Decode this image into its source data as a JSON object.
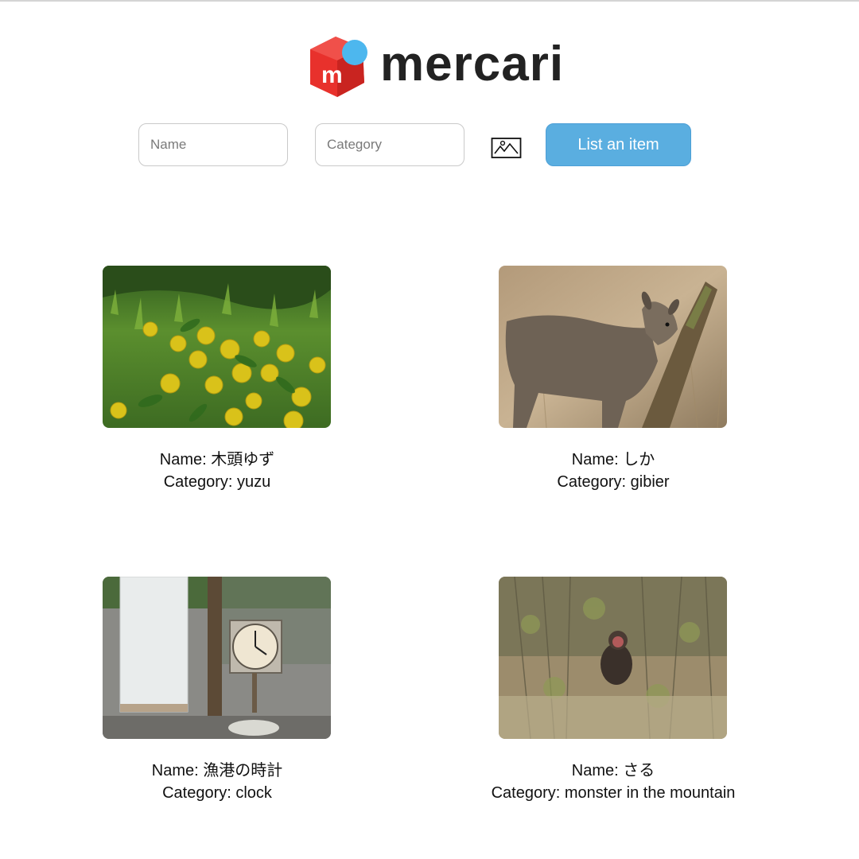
{
  "header": {
    "brand": "mercari",
    "cube_letter": "m",
    "brand_red": "#e8312c",
    "brand_blue": "#4db7ee"
  },
  "form": {
    "name_placeholder": "Name",
    "category_placeholder": "Category",
    "image_icon": "image-upload-icon",
    "submit_label": "List an item",
    "button_color": "#5aaee0"
  },
  "items": [
    {
      "name_label": "Name: 木頭ゆず",
      "category_label": "Category: yuzu",
      "image": "yuzu-fruit-photo"
    },
    {
      "name_label": "Name: しか",
      "category_label": "Category: gibier",
      "image": "deer-photo"
    },
    {
      "name_label": "Name: 漁港の時計",
      "category_label": "Category: clock",
      "image": "harbor-clock-photo"
    },
    {
      "name_label": "Name: さる",
      "category_label": "Category: monster in the mountain",
      "image": "monkey-photo"
    }
  ]
}
